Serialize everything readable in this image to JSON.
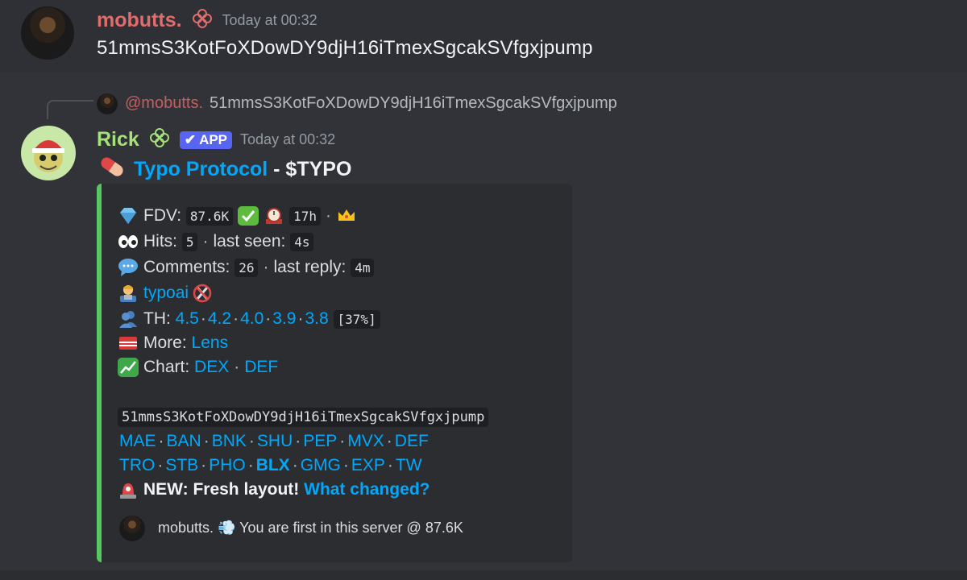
{
  "message1": {
    "username": "mobutts.",
    "timestamp": "Today at 00:32",
    "text": "51mmsS3KotFoXDowDY9djH16iTmexSgcakSVfgxjpump"
  },
  "reply_ref": {
    "username": "@mobutts.",
    "text": "51mmsS3KotFoXDowDY9djH16iTmexSgcakSVfgxjpump"
  },
  "message2": {
    "username": "Rick",
    "badge": "APP",
    "timestamp": "Today at 00:32",
    "title_link": "Typo Protocol",
    "title_sep": " - ",
    "ticker": "$TYPO"
  },
  "embed": {
    "fdv_label": "FDV:",
    "fdv_value": "87.6K",
    "age_value": "17h",
    "hits_label": "Hits:",
    "hits_value": "5",
    "last_seen_label": "last seen:",
    "last_seen_value": "4s",
    "comments_label": "Comments:",
    "comments_value": "26",
    "last_reply_label": "last reply:",
    "last_reply_value": "4m",
    "creator": "typoai",
    "th_label": "TH:",
    "th_values": [
      "4.5",
      "4.2",
      "4.0",
      "3.9",
      "3.8"
    ],
    "th_pct": "[37%]",
    "more_label": "More:",
    "more_link": "Lens",
    "chart_label": "Chart:",
    "chart_links": [
      "DEX",
      "DEF"
    ],
    "contract": "51mmsS3KotFoXDowDY9djH16iTmexSgcakSVfgxjpump",
    "links_row1": [
      "MAE",
      "BAN",
      "BNK",
      "SHU",
      "PEP",
      "MVX",
      "DEF"
    ],
    "links_row2": [
      "TRO",
      "STB",
      "PHO",
      "BLX",
      "GMG",
      "EXP",
      "TW"
    ],
    "new_label": "NEW: Fresh layout!",
    "new_link": "What changed?",
    "footer": "mobutts. 💨 You are first in this server @ 87.6K"
  },
  "colors": {
    "background": "#313338",
    "mobutts_name": "#e06c6c",
    "rick_name": "#a6e07a",
    "app_badge": "#5865f2",
    "link": "#00a8fc",
    "embed_bar": "#57c85f"
  }
}
